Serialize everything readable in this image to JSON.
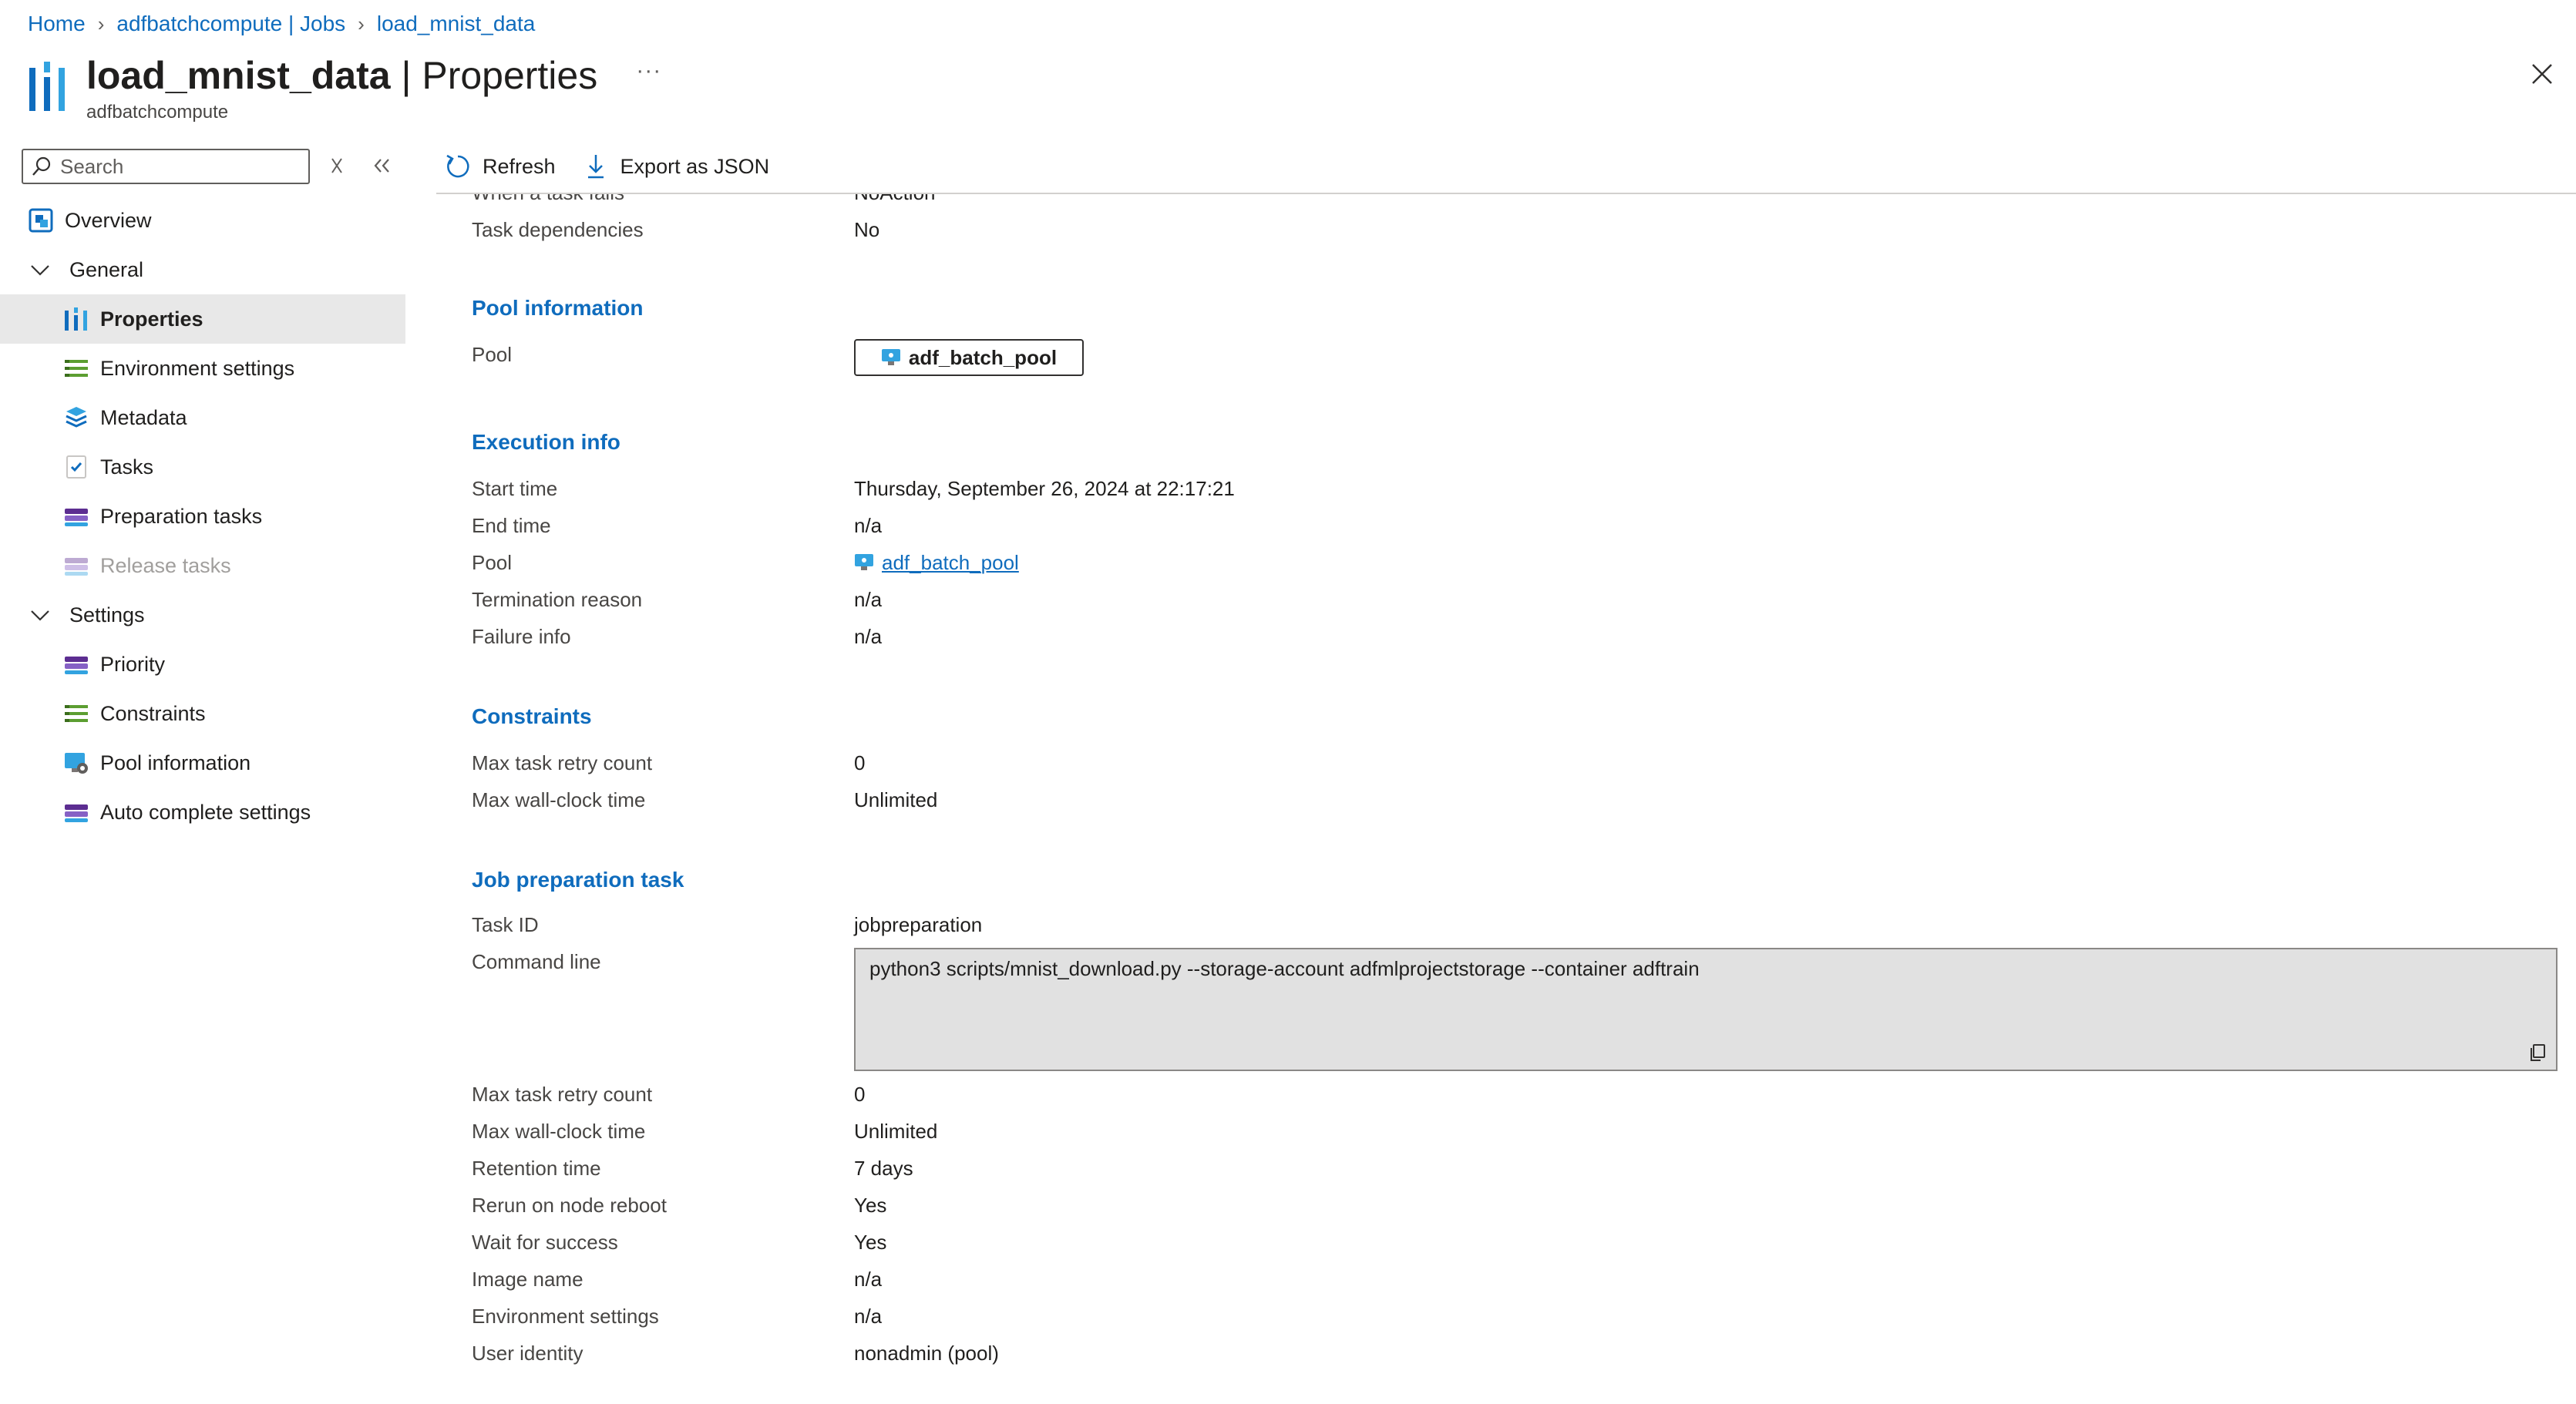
{
  "breadcrumb": {
    "items": [
      "Home",
      "adfbatchcompute | Jobs",
      "load_mnist_data"
    ]
  },
  "header": {
    "resource": "load_mnist_data",
    "separator": " | ",
    "blade": "Properties",
    "subtitle": "adfbatchcompute",
    "more": "···"
  },
  "search": {
    "placeholder": "Search"
  },
  "nav": {
    "overview": "Overview",
    "general": "General",
    "properties": "Properties",
    "environment_settings": "Environment settings",
    "metadata": "Metadata",
    "tasks": "Tasks",
    "preparation_tasks": "Preparation tasks",
    "release_tasks": "Release tasks",
    "settings": "Settings",
    "priority": "Priority",
    "constraints": "Constraints",
    "pool_information": "Pool information",
    "auto_complete_settings": "Auto complete settings"
  },
  "toolbar": {
    "refresh": "Refresh",
    "export": "Export as JSON"
  },
  "content": {
    "top": {
      "when_task_fails_label": "When a task fails",
      "when_task_fails_value": "NoAction",
      "task_dependencies_label": "Task dependencies",
      "task_dependencies_value": "No"
    },
    "pool_info": {
      "title": "Pool information",
      "pool_label": "Pool",
      "pool_value": "adf_batch_pool"
    },
    "execution": {
      "title": "Execution info",
      "start_time_label": "Start time",
      "start_time_value": "Thursday, September 26, 2024 at 22:17:21",
      "end_time_label": "End time",
      "end_time_value": "n/a",
      "pool_label": "Pool",
      "pool_value": "adf_batch_pool",
      "termination_reason_label": "Termination reason",
      "termination_reason_value": "n/a",
      "failure_info_label": "Failure info",
      "failure_info_value": "n/a"
    },
    "constraints": {
      "title": "Constraints",
      "max_retry_label": "Max task retry count",
      "max_retry_value": "0",
      "max_wall_label": "Max wall-clock time",
      "max_wall_value": "Unlimited"
    },
    "job_prep": {
      "title": "Job preparation task",
      "task_id_label": "Task ID",
      "task_id_value": "jobpreparation",
      "command_line_label": "Command line",
      "command_line_value": "python3 scripts/mnist_download.py --storage-account adfmlprojectstorage --container adftrain",
      "max_retry_label": "Max task retry count",
      "max_retry_value": "0",
      "max_wall_label": "Max wall-clock time",
      "max_wall_value": "Unlimited",
      "retention_label": "Retention time",
      "retention_value": "7 days",
      "rerun_label": "Rerun on node reboot",
      "rerun_value": "Yes",
      "wait_label": "Wait for success",
      "wait_value": "Yes",
      "image_label": "Image name",
      "image_value": "n/a",
      "env_label": "Environment settings",
      "env_value": "n/a",
      "identity_label": "User identity",
      "identity_value": "nonadmin (pool)"
    }
  },
  "colors": {
    "accent": "#0f6cbd",
    "selected_bg": "#e8e8e8",
    "command_bg": "#e1e1e1"
  }
}
